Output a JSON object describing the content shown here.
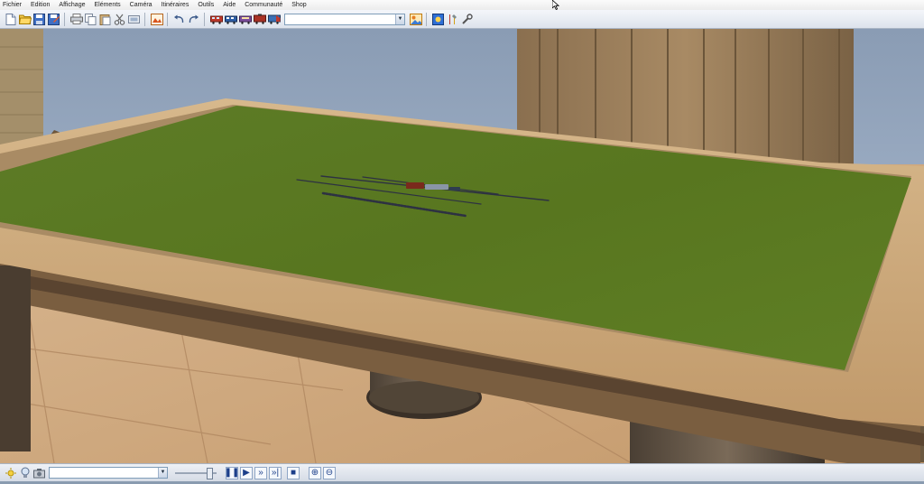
{
  "menu": {
    "items": [
      "Fichier",
      "Edition",
      "Affichage",
      "Eléments",
      "Caméra",
      "Itinéraires",
      "Outils",
      "Aide",
      "Communauté",
      "Shop"
    ]
  },
  "toolbar": {
    "selector_value": "",
    "buttons": [
      "new-file-icon",
      "open-folder-icon",
      "save-icon",
      "save-as-icon",
      "print-icon",
      "copy-icon",
      "paste-icon",
      "cut-icon",
      "layer-icon",
      "image-icon",
      "undo-icon",
      "redo-icon",
      "train-a-icon",
      "train-b-icon",
      "train-c-icon",
      "train-d-icon",
      "train-e-icon"
    ],
    "right_buttons": [
      "picture-icon",
      "settings-icon",
      "tools-icon",
      "wrench-icon"
    ]
  },
  "bottombar": {
    "selector_value": "",
    "speed_level": 0.9
  },
  "colors": {
    "toolbar": "#e6ebf2",
    "wall": "#8ea0b6",
    "table_frame": "#c9a57a",
    "grass": "#5b7a25",
    "floor": "#d7b68f"
  }
}
